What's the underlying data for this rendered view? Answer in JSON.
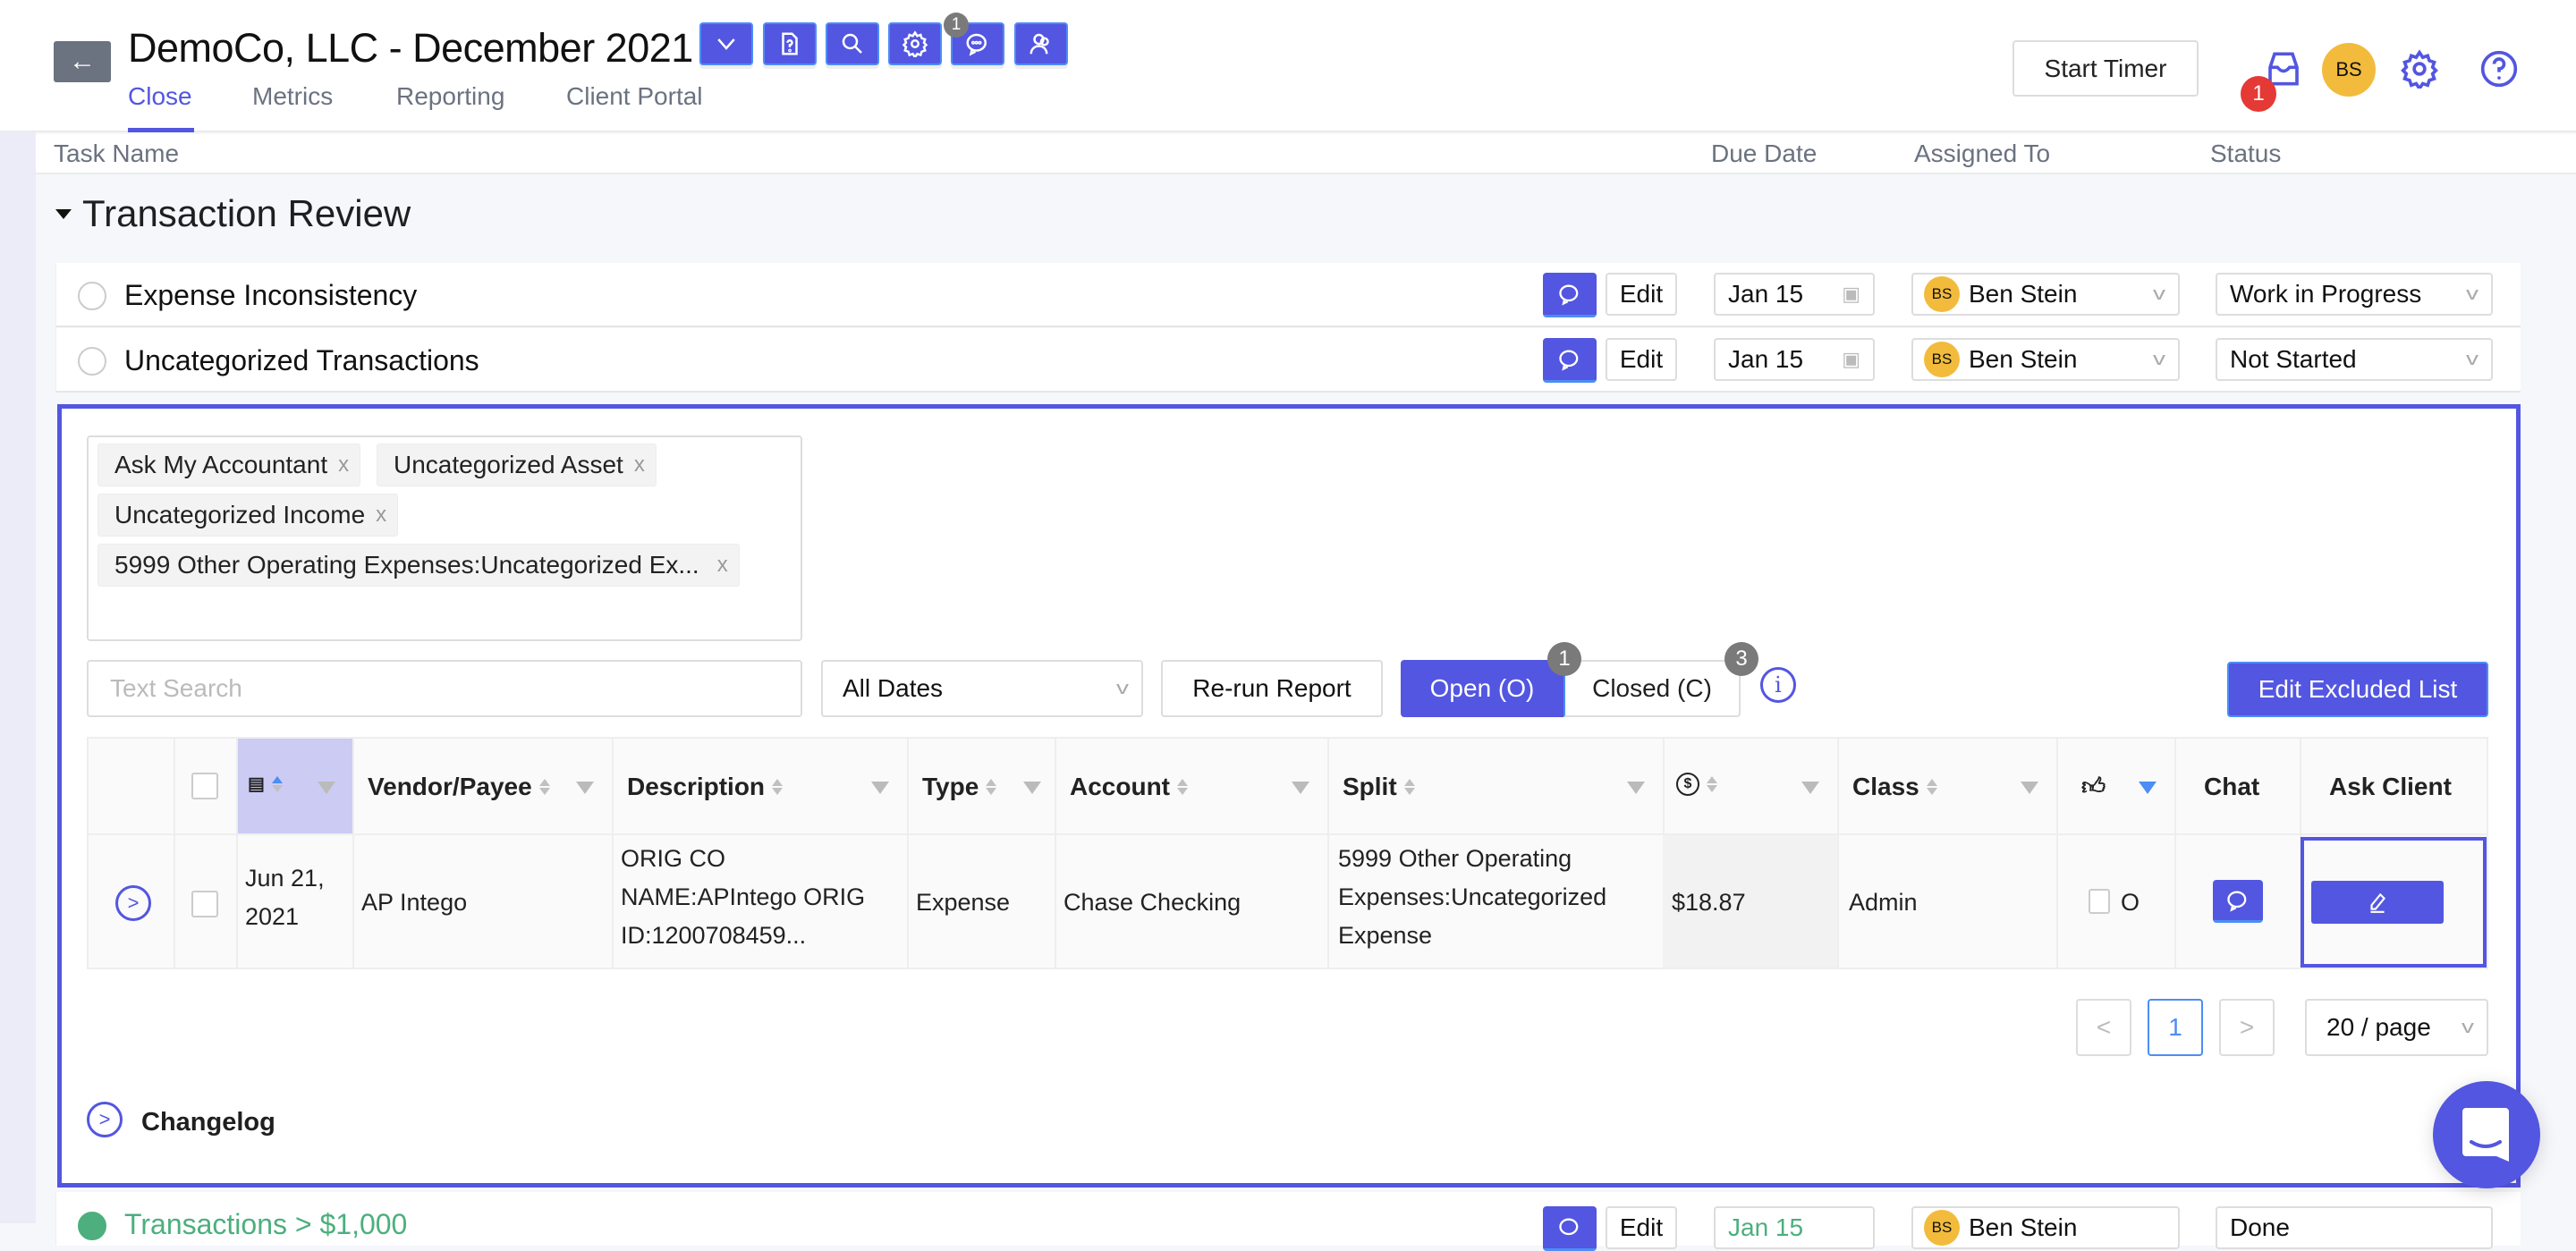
{
  "header": {
    "title": "DemoCo, LLC - December 2021",
    "toolbar_icons": [
      {
        "name": "chevron-down-icon"
      },
      {
        "name": "document-question-icon"
      },
      {
        "name": "search-icon"
      },
      {
        "name": "gear-icon"
      },
      {
        "name": "chat-icon",
        "badge": "1"
      },
      {
        "name": "users-icon"
      }
    ],
    "tabs": [
      {
        "label": "Close",
        "active": true
      },
      {
        "label": "Metrics",
        "active": false
      },
      {
        "label": "Reporting",
        "active": false
      },
      {
        "label": "Client Portal",
        "active": false
      }
    ],
    "start_timer_label": "Start Timer",
    "inbox_badge": "1",
    "user_initials": "BS"
  },
  "columns": {
    "task_name": "Task Name",
    "due_date": "Due Date",
    "assigned_to": "Assigned To",
    "status": "Status"
  },
  "section": {
    "title": "Transaction Review",
    "tasks": [
      {
        "name": "Expense Inconsistency",
        "edit_label": "Edit",
        "due": "Jan 15",
        "assignee": "Ben Stein",
        "assignee_initials": "BS",
        "status": "Work in Progress"
      },
      {
        "name": "Uncategorized Transactions",
        "edit_label": "Edit",
        "due": "Jan 15",
        "assignee": "Ben Stein",
        "assignee_initials": "BS",
        "status": "Not Started"
      },
      {
        "name": "Transactions > $1,000",
        "edit_label": "Edit",
        "due": "Jan 15",
        "assignee": "Ben Stein",
        "assignee_initials": "BS",
        "status": "Done"
      }
    ]
  },
  "panel": {
    "excluded_tags": [
      "Ask My Accountant",
      "Uncategorized Asset",
      "Uncategorized Income",
      "5999 Other Operating Expenses:Uncategorized Ex..."
    ],
    "tag_remove_glyph": "x",
    "search_placeholder": "Text Search",
    "date_filter": "All Dates",
    "rerun_label": "Re-run Report",
    "open_label": "Open (O)",
    "open_count": "1",
    "closed_label": "Closed (C)",
    "closed_count": "3",
    "info_glyph": "i",
    "edit_excluded_label": "Edit Excluded List",
    "table": {
      "headers": [
        "Vendor/Payee",
        "Description",
        "Type",
        "Account",
        "Split",
        "Class",
        "Chat",
        "Ask Client"
      ],
      "rows": [
        {
          "date": "Jun 21, 2021",
          "vendor": "AP Intego",
          "description": "ORIG CO NAME:APIntego ORIG ID:1200708459...",
          "type": "Expense",
          "account": "Chase Checking",
          "split": "5999 Other Operating Expenses:Uncategorized Expense",
          "amount": "$18.87",
          "class": "Admin",
          "approve_count": "O"
        }
      ]
    },
    "pagination": {
      "prev": "<",
      "current": "1",
      "next": ">",
      "page_size": "20 / page"
    },
    "changelog_label": "Changelog"
  },
  "colors": {
    "accent": "#5356e0",
    "avatar": "#f2bb3c",
    "badge_red": "#e53935",
    "done_green": "#4caf7d"
  }
}
